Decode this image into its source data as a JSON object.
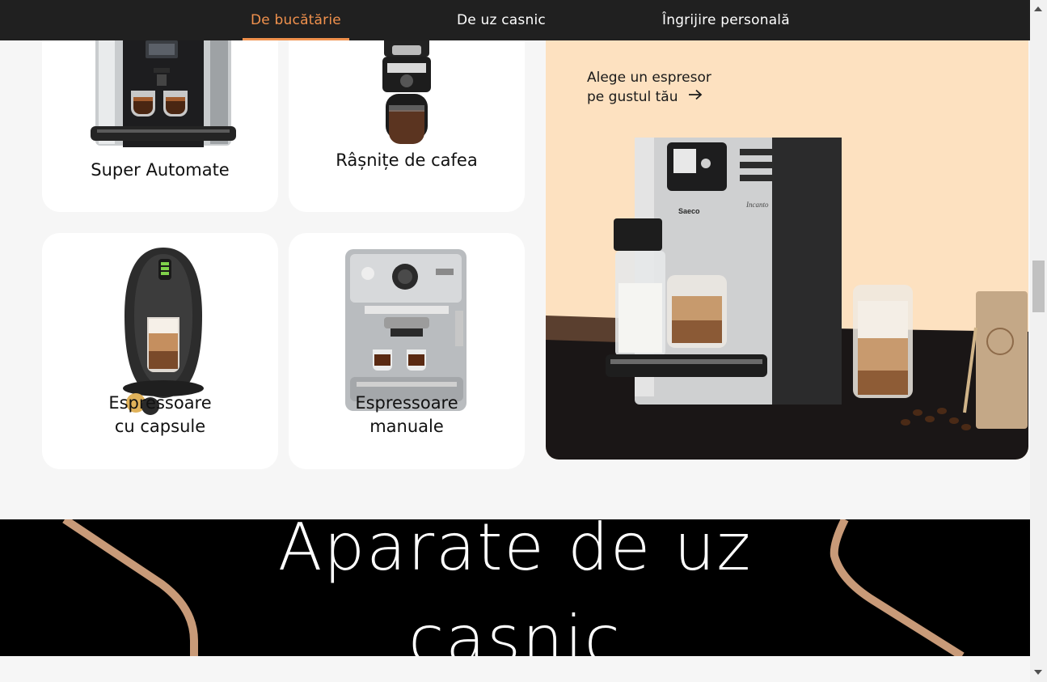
{
  "nav": {
    "tabs": [
      {
        "label": "De bucătărie",
        "active": true
      },
      {
        "label": "De uz casnic",
        "active": false
      },
      {
        "label": "Îngrijire personală",
        "active": false
      }
    ],
    "active_color": "#f0914d"
  },
  "categories": [
    {
      "label": "Super Automate",
      "icon": "super-automatic-machine-image"
    },
    {
      "label": "Râșnițe de cafea",
      "icon": "coffee-grinder-image"
    },
    {
      "label": "Espressoare\ncu capsule",
      "icon": "capsule-espresso-machine-image"
    },
    {
      "label": "Espressoare\nmanuale",
      "icon": "manual-espresso-machine-image"
    }
  ],
  "promo": {
    "link_text": "Alege un espresor\npe gustul tău",
    "arrow_icon": "arrow-right-icon",
    "brand_text": "Saeco",
    "model_text": "Incanto",
    "background": "#fde1c0"
  },
  "section": {
    "title": "Aparate de uz\ncasnic",
    "background": "#000000",
    "accent": "#c89a78"
  }
}
